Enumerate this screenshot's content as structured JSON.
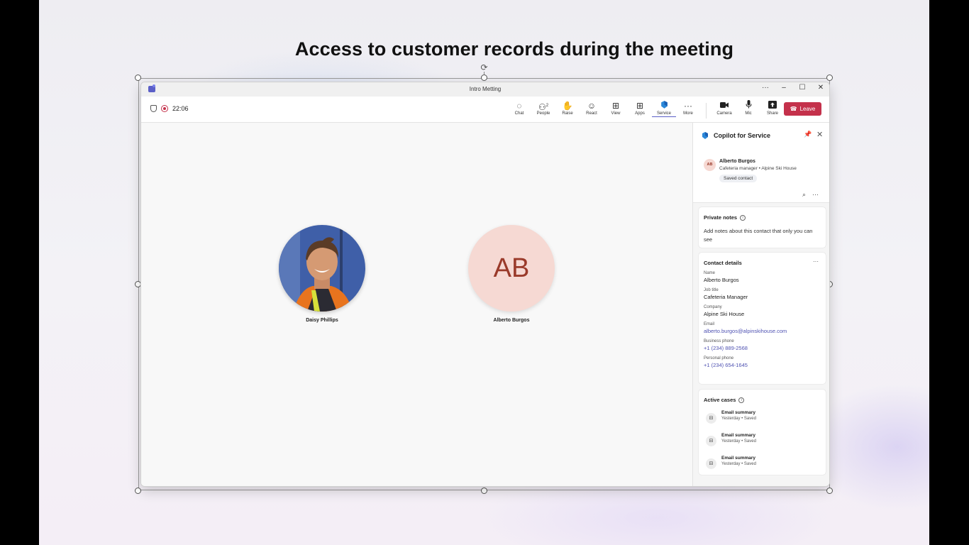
{
  "headline": "Access to customer records during the meeting",
  "window": {
    "title": "Intro Metting",
    "controls": [
      "···",
      "–",
      "☐",
      "✕"
    ]
  },
  "toolbar": {
    "timer": "22:06",
    "tools": [
      {
        "label": "Chat",
        "icon": "chat-icon",
        "glyph": "◌"
      },
      {
        "label": "People",
        "icon": "people-icon",
        "glyph": "⚇2"
      },
      {
        "label": "Raise",
        "icon": "raise-hand-icon",
        "glyph": "✋"
      },
      {
        "label": "React",
        "icon": "react-icon",
        "glyph": "☺"
      },
      {
        "label": "View",
        "icon": "view-icon",
        "glyph": "⊞"
      },
      {
        "label": "Apps",
        "icon": "apps-icon",
        "glyph": "⊞"
      },
      {
        "label": "Service",
        "icon": "service-icon",
        "glyph": "◆"
      },
      {
        "label": "More",
        "icon": "more-icon",
        "glyph": "···"
      }
    ],
    "media": [
      {
        "label": "Camera",
        "icon": "camera-icon",
        "glyph": "■"
      },
      {
        "label": "Mic",
        "icon": "mic-icon",
        "glyph": "🎙"
      },
      {
        "label": "Share",
        "icon": "share-icon",
        "glyph": "⬆"
      }
    ],
    "active_tool": "Service",
    "leave_label": "Leave",
    "leave_color": "#c4314b"
  },
  "participants": [
    {
      "name": "Daisy Phillips",
      "type": "photo"
    },
    {
      "name": "Alberto Burgos",
      "type": "initials",
      "initials": "AB"
    }
  ],
  "panel": {
    "title": "Copilot for Service",
    "contact": {
      "initials": "AB",
      "name": "Alberto Burgos",
      "subtitle": "Cafeteria manager • Alpine Ski House",
      "tag": "Saved contact"
    },
    "private_notes": {
      "title": "Private notes",
      "body": "Add notes about this contact that only you can see"
    },
    "contact_details": {
      "title": "Contact details",
      "fields": [
        {
          "label": "Name",
          "value": "Alberto Burgos",
          "link": false
        },
        {
          "label": "Job title",
          "value": "Cafeteria Manager",
          "link": false
        },
        {
          "label": "Company",
          "value": "Alpine Ski House",
          "link": false
        },
        {
          "label": "Email",
          "value": "alberto.burgos@alpinskihouse.com",
          "link": true
        },
        {
          "label": "Business phone",
          "value": "+1 (234) 889-2568",
          "link": true
        },
        {
          "label": "Personal phone",
          "value": "+1 (234) 654-1645",
          "link": true
        }
      ]
    },
    "active_cases": {
      "title": "Active cases",
      "items": [
        {
          "title": "Email summary",
          "status": "Yesterday • Saved"
        },
        {
          "title": "Email summary",
          "status": "Yesterday • Saved"
        },
        {
          "title": "Email summary",
          "status": "Yesterday • Saved"
        }
      ]
    }
  }
}
